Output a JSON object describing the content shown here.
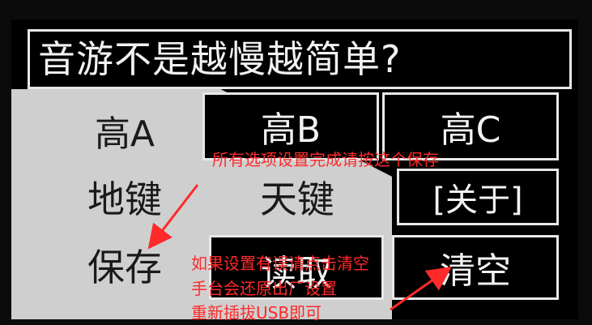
{
  "screen": {
    "title": "音游不是越慢越简单?",
    "buttons": {
      "high_a": "高A",
      "high_b": "高B",
      "high_c": "高C",
      "ground_key": "地键",
      "sky_key": "天键",
      "about": "[关于]",
      "save": "保存",
      "read": "读取",
      "clear": "清空"
    }
  },
  "annotations": {
    "save_hint": "所有选项设置完成请按这个保存",
    "clear_hint_line1": "如果设置有误请点击清空",
    "clear_hint_line2": "手台会还原出厂设置",
    "clear_hint_line3": "重新插拔USB即可"
  },
  "colors": {
    "screen_background": "#000000",
    "light_region": "#cfcfcf",
    "annotation_red": "#ff2a2a"
  }
}
